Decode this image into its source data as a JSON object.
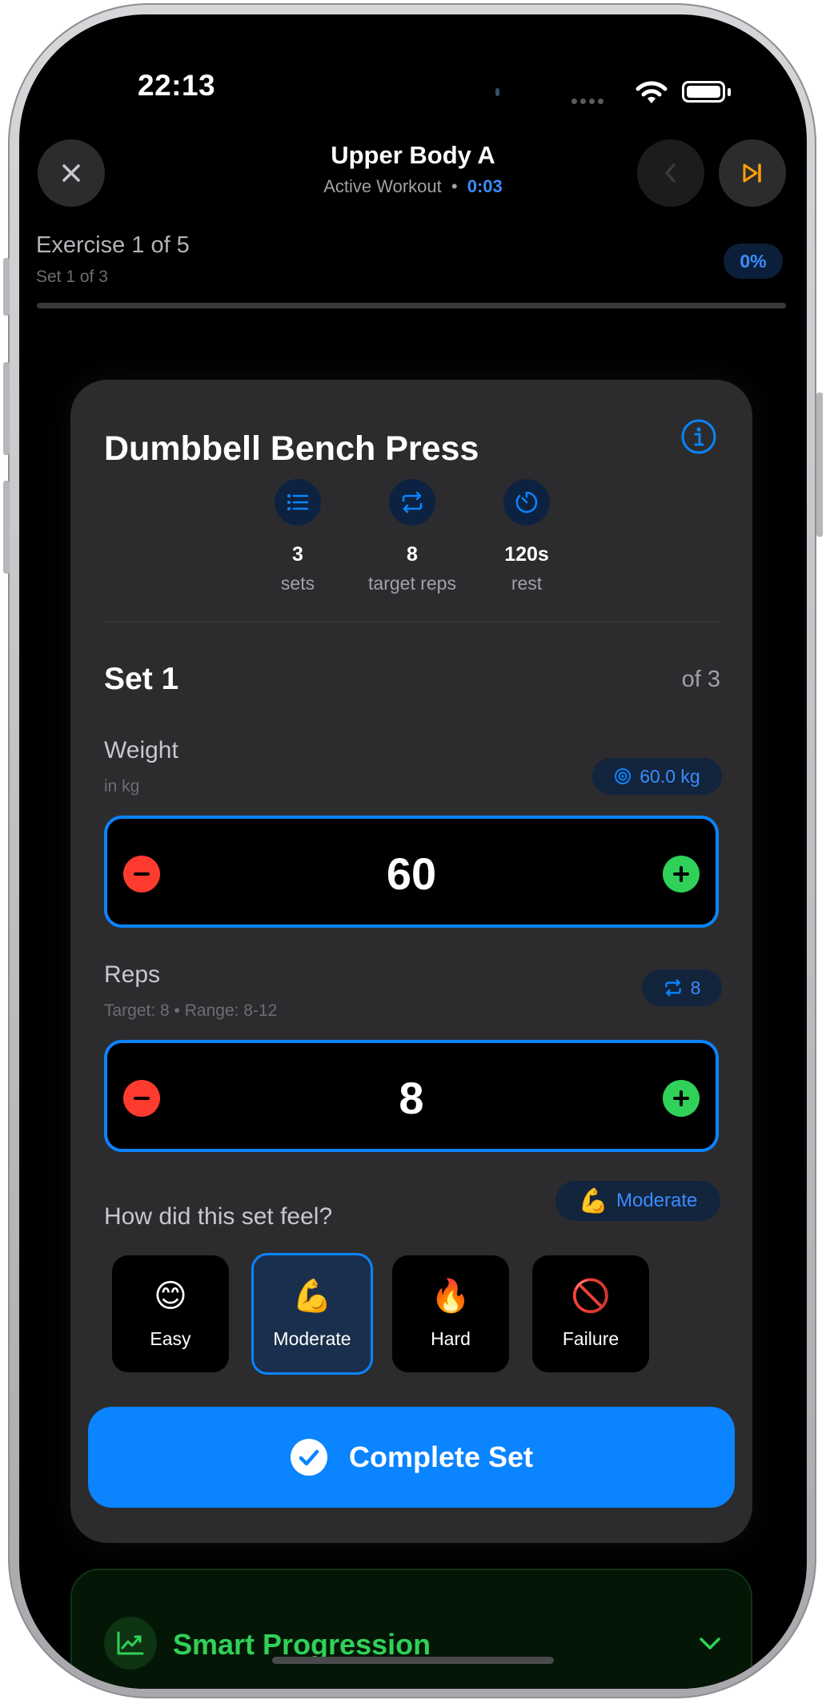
{
  "status": {
    "time": "22:13"
  },
  "nav": {
    "title": "Upper Body A",
    "subtitle": "Active Workout",
    "separator": "•",
    "elapsed": "0:03"
  },
  "progress": {
    "exercise": "Exercise 1 of 5",
    "set": "Set 1 of 3",
    "percent_label": "0%",
    "fraction": 0.0
  },
  "exercise": {
    "name": "Dumbbell Bench Press",
    "stats": [
      {
        "icon": "list-icon",
        "value": "3",
        "label": "sets"
      },
      {
        "icon": "repeat-icon",
        "value": "8",
        "label": "target reps"
      },
      {
        "icon": "timer-icon",
        "value": "120s",
        "label": "rest"
      }
    ]
  },
  "set": {
    "title": "Set 1",
    "of": "of 3"
  },
  "weight": {
    "label": "Weight",
    "sub": "in kg",
    "chip": "60.0 kg",
    "value": "60"
  },
  "reps": {
    "label": "Reps",
    "sub": "Target: 8 • Range: 8-12",
    "chip": "8",
    "value": "8"
  },
  "feel": {
    "question": "How did this set feel?",
    "chip_emoji": "💪",
    "chip_label": "Moderate",
    "options": [
      {
        "emoji": "😊",
        "label": "Easy",
        "selected": false
      },
      {
        "emoji": "💪",
        "label": "Moderate",
        "selected": true
      },
      {
        "emoji": "🔥",
        "label": "Hard",
        "selected": false
      },
      {
        "emoji": "🚫",
        "label": "Failure",
        "selected": false
      }
    ]
  },
  "complete": {
    "label": "Complete Set"
  },
  "smart": {
    "label": "Smart Progression"
  },
  "colors": {
    "accent": "#0a84ff",
    "minus": "#ff3b30",
    "plus": "#30d158",
    "skip": "#ff9f0a",
    "card": "#2c2c2e"
  }
}
